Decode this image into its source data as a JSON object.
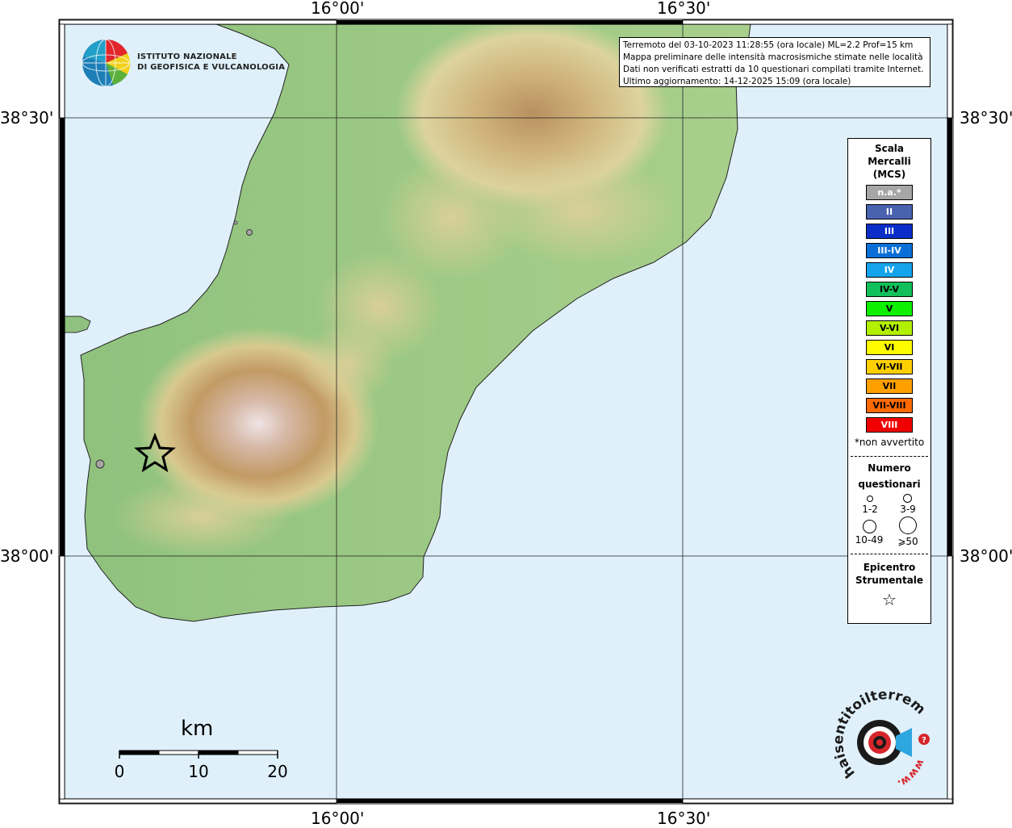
{
  "info": {
    "line1": "Terremoto del 03-10-2023 11:28:55 (ora locale) ML=2.2 Prof=15 km",
    "line2": "Mappa preliminare delle intensità macrosismiche stimate nelle località",
    "line3": "Dati non verificati estratti da 10 questionari compilati tramite Internet.",
    "line4": "Ultimo aggiornamento: 14-12-2025 15:09 (ora locale)"
  },
  "logo": {
    "line1": "ISTITUTO NAZIONALE",
    "line2": "DI GEOFISICA E VULCANOLOGIA"
  },
  "coords": {
    "top_lon1": "16°00'",
    "top_lon2": "16°30'",
    "bottom_lon1": "16°00'",
    "bottom_lon2": "16°30'",
    "left_lat1": "38°30'",
    "left_lat2": "38°00'",
    "right_lat1": "38°30'",
    "right_lat2": "38°00'"
  },
  "scalebar": {
    "unit": "km",
    "ticks": [
      "0",
      "10",
      "20"
    ]
  },
  "legend": {
    "title": [
      "Scala",
      "Mercalli",
      "(MCS)"
    ],
    "scale": [
      {
        "label": "n.a.*",
        "color": "#a6a6a6",
        "text_color": "#ffffff"
      },
      {
        "label": "II",
        "color": "#4a63b0",
        "text_color": "#ffffff"
      },
      {
        "label": "III",
        "color": "#0a2ec7",
        "text_color": "#ffffff"
      },
      {
        "label": "III-IV",
        "color": "#0a6fd6",
        "text_color": "#ffffff"
      },
      {
        "label": "IV",
        "color": "#15a4ec",
        "text_color": "#ffffff"
      },
      {
        "label": "IV-V",
        "color": "#11c05a",
        "text_color": "#000000"
      },
      {
        "label": "V",
        "color": "#0df000",
        "text_color": "#000000"
      },
      {
        "label": "V-VI",
        "color": "#b2f000",
        "text_color": "#000000"
      },
      {
        "label": "VI",
        "color": "#fffb00",
        "text_color": "#000000"
      },
      {
        "label": "VI-VII",
        "color": "#ffcf00",
        "text_color": "#000000"
      },
      {
        "label": "VII",
        "color": "#ffa000",
        "text_color": "#000000"
      },
      {
        "label": "VII-VIII",
        "color": "#ff6a00",
        "text_color": "#000000"
      },
      {
        "label": "VIII",
        "color": "#f00000",
        "text_color": "#ffffff"
      }
    ],
    "note": "*non avvertito",
    "count_title": [
      "Numero",
      "questionari"
    ],
    "count_labels": [
      "1-2",
      "3-9",
      "10-49",
      "⩾50"
    ],
    "epicenter_title": [
      "Epicentro",
      "Strumentale"
    ]
  },
  "haisentito": {
    "text": "haisentitoilterremoto.it",
    "www": "www."
  },
  "colors": {
    "sea": "#dff0fb",
    "frame": "#000000"
  }
}
